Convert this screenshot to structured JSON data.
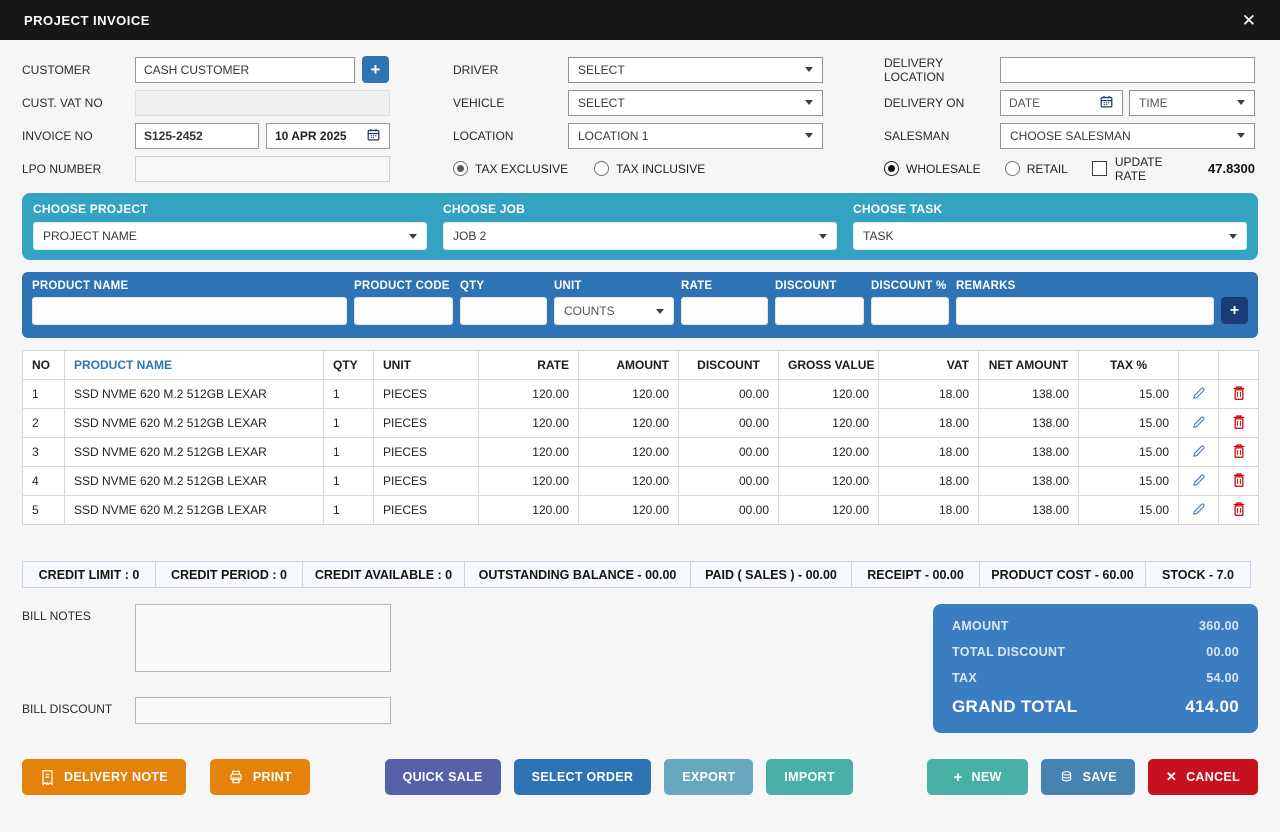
{
  "header": {
    "title": "PROJECT INVOICE",
    "close_icon": "✕"
  },
  "form": {
    "customer": {
      "label": "CUSTOMER",
      "value": "CASH CUSTOMER",
      "add_button": "+"
    },
    "cust_vat_no": {
      "label": "CUST. VAT NO",
      "value": ""
    },
    "invoice_no": {
      "label": "INVOICE NO",
      "value": "S125-2452",
      "date": "10 APR 2025"
    },
    "lpo_number": {
      "label": "LPO NUMBER",
      "value": ""
    },
    "driver": {
      "label": "DRIVER",
      "value": "SELECT"
    },
    "vehicle": {
      "label": "VEHICLE",
      "value": "SELECT"
    },
    "location": {
      "label": "LOCATION",
      "value": "LOCATION 1"
    },
    "tax_mode": {
      "selected": "TAX EXCLUSIVE",
      "options": [
        "TAX EXCLUSIVE",
        "TAX INCLUSIVE"
      ]
    },
    "delivery_location": {
      "label": "DELIVERY LOCATION",
      "value": ""
    },
    "delivery_on": {
      "label": "DELIVERY ON",
      "date_placeholder": "DATE",
      "time_placeholder": "TIME"
    },
    "salesman": {
      "label": "SALESMAN",
      "value": "CHOOSE SALESMAN"
    },
    "price_mode": {
      "selected": "WHOLESALE",
      "options": [
        "WHOLESALE",
        "RETAIL"
      ]
    },
    "update_rate": {
      "label": "UPDATE RATE",
      "checked": false
    },
    "exchange_rate": "47.8300"
  },
  "project_bar": {
    "project": {
      "label": "CHOOSE PROJECT",
      "value": "PROJECT NAME"
    },
    "job": {
      "label": "CHOOSE JOB",
      "value": "JOB 2"
    },
    "task": {
      "label": "CHOOSE TASK",
      "value": "TASK"
    }
  },
  "entry_bar": {
    "product_name_label": "PRODUCT NAME",
    "product_code_label": "PRODUCT CODE",
    "qty_label": "QTY",
    "unit_label": "UNIT",
    "unit_value": "COUNTS",
    "rate_label": "RATE",
    "discount_label": "DISCOUNT",
    "discount_pct_label": "DISCOUNT %",
    "remarks_label": "REMARKS",
    "add_button": "+"
  },
  "table": {
    "columns": [
      "NO",
      "PRODUCT NAME",
      "QTY",
      "UNIT",
      "RATE",
      "AMOUNT",
      "DISCOUNT",
      "GROSS VALUE",
      "VAT",
      "NET AMOUNT",
      "TAX %"
    ],
    "rows": [
      {
        "no": "1",
        "product": "SSD NVME 620 M.2 512GB LEXAR",
        "qty": "1",
        "unit": "PIECES",
        "rate": "120.00",
        "amount": "120.00",
        "discount": "00.00",
        "gross": "120.00",
        "vat": "18.00",
        "net": "138.00",
        "tax": "15.00"
      },
      {
        "no": "2",
        "product": "SSD NVME 620 M.2 512GB LEXAR",
        "qty": "1",
        "unit": "PIECES",
        "rate": "120.00",
        "amount": "120.00",
        "discount": "00.00",
        "gross": "120.00",
        "vat": "18.00",
        "net": "138.00",
        "tax": "15.00"
      },
      {
        "no": "3",
        "product": "SSD NVME 620 M.2 512GB LEXAR",
        "qty": "1",
        "unit": "PIECES",
        "rate": "120.00",
        "amount": "120.00",
        "discount": "00.00",
        "gross": "120.00",
        "vat": "18.00",
        "net": "138.00",
        "tax": "15.00"
      },
      {
        "no": "4",
        "product": "SSD NVME 620 M.2 512GB LEXAR",
        "qty": "1",
        "unit": "PIECES",
        "rate": "120.00",
        "amount": "120.00",
        "discount": "00.00",
        "gross": "120.00",
        "vat": "18.00",
        "net": "138.00",
        "tax": "15.00"
      },
      {
        "no": "5",
        "product": "SSD NVME 620 M.2 512GB LEXAR",
        "qty": "1",
        "unit": "PIECES",
        "rate": "120.00",
        "amount": "120.00",
        "discount": "00.00",
        "gross": "120.00",
        "vat": "18.00",
        "net": "138.00",
        "tax": "15.00"
      }
    ]
  },
  "credit_bar": [
    "CREDIT LIMIT :  0",
    "CREDIT PERIOD :  0",
    "CREDIT AVAILABLE :  0",
    "OUTSTANDING BALANCE - 00.00",
    "PAID ( SALES ) - 00.00",
    "RECEIPT - 00.00",
    "PRODUCT COST - 60.00",
    "STOCK - 7.0"
  ],
  "bill": {
    "notes_label": "BILL NOTES",
    "discount_label": "BILL DISCOUNT"
  },
  "summary": {
    "rows": [
      {
        "label": "AMOUNT",
        "value": "360.00"
      },
      {
        "label": "TOTAL DISCOUNT",
        "value": "00.00"
      },
      {
        "label": "TAX",
        "value": "54.00"
      }
    ],
    "grand_label": "GRAND TOTAL",
    "grand_value": "414.00"
  },
  "actions": {
    "delivery_note": "DELIVERY NOTE",
    "print": "PRINT",
    "quick_sale": "QUICK SALE",
    "select_order": "SELECT ORDER",
    "export": "EXPORT",
    "import": "IMPORT",
    "new": "NEW",
    "save": "SAVE",
    "cancel": "CANCEL"
  },
  "colors": {
    "titlebar": "#171717",
    "teal_panel": "#33a3c1",
    "blue_panel": "#2e73b4",
    "summary_card": "#3b7dc1",
    "orange": "#e5820c",
    "indigo": "#5562a9",
    "steel_blue": "#4583b0",
    "light_steel": "#68a7c0",
    "teal_green": "#48b0a4",
    "red": "#c8101e",
    "navy_add_button": "#1b3a78",
    "table_header_link": "#2e74b5"
  }
}
